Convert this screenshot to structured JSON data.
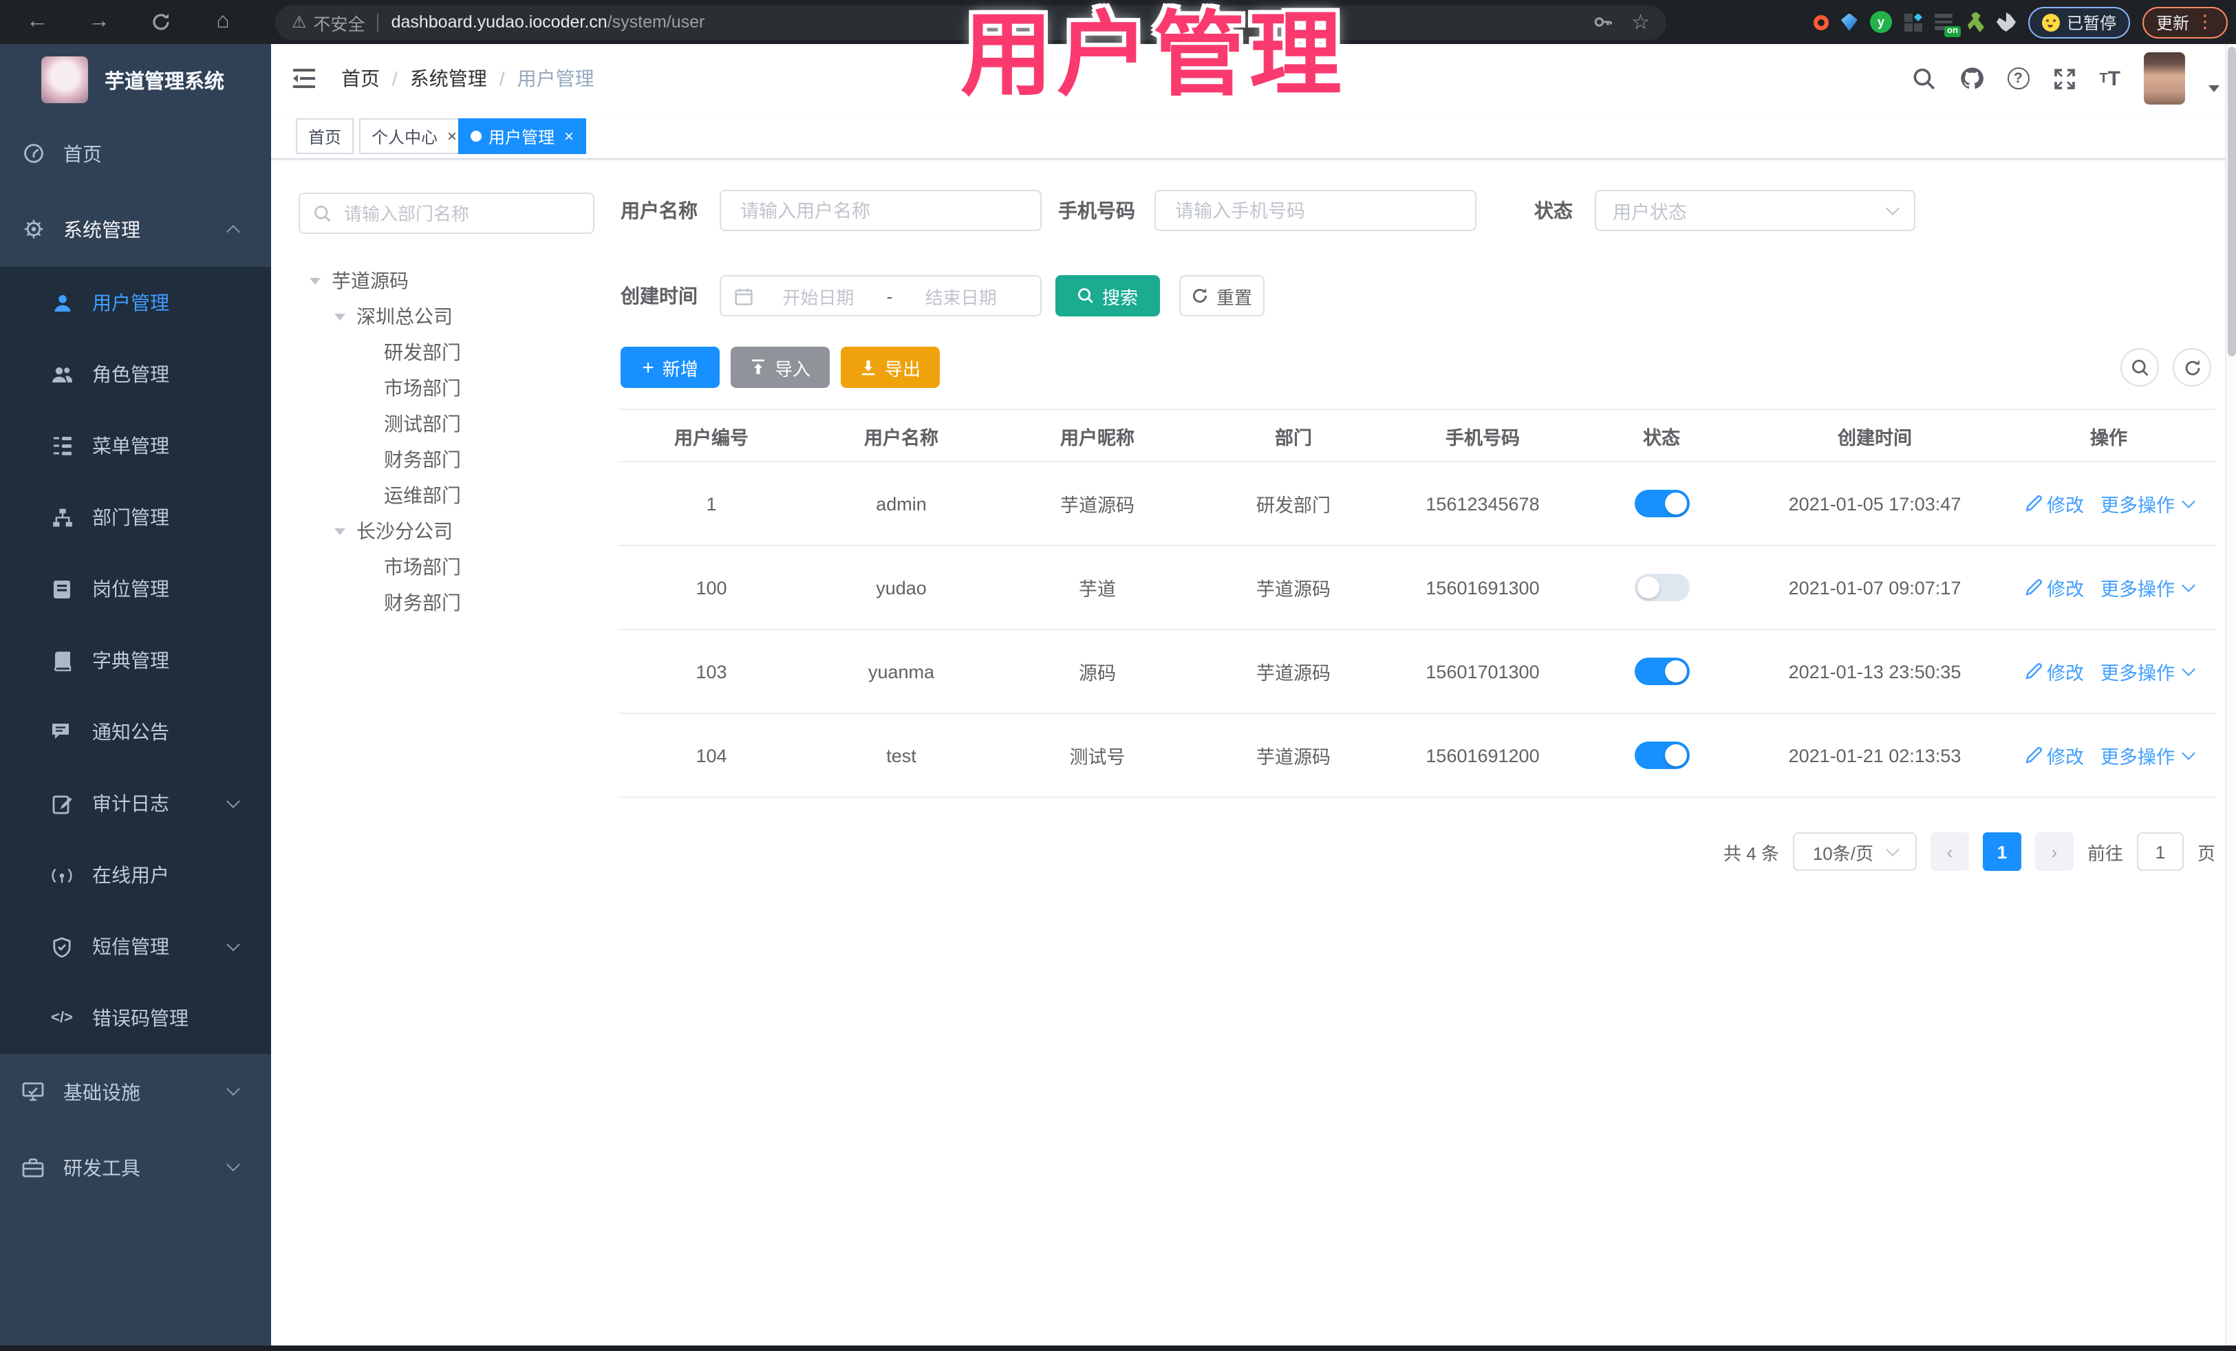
{
  "overlay": {
    "title": "用户管理",
    "color": "#fa3a6e"
  },
  "browser": {
    "security_label": "不安全",
    "url_host": "dashboard.yudao.iocoder.cn",
    "url_path": "/system/user",
    "extension_on_badge": "on",
    "paused_badge": "已暂停",
    "update_label": "更新"
  },
  "sidebar": {
    "app_title": "芋道管理系统",
    "items": [
      {
        "label": "首页"
      },
      {
        "label": "系统管理"
      },
      {
        "label": "基础设施"
      },
      {
        "label": "研发工具"
      }
    ],
    "system_children": [
      {
        "label": "用户管理"
      },
      {
        "label": "角色管理"
      },
      {
        "label": "菜单管理"
      },
      {
        "label": "部门管理"
      },
      {
        "label": "岗位管理"
      },
      {
        "label": "字典管理"
      },
      {
        "label": "通知公告"
      },
      {
        "label": "审计日志"
      },
      {
        "label": "在线用户"
      },
      {
        "label": "短信管理"
      },
      {
        "label": "错误码管理"
      }
    ]
  },
  "navbar": {
    "breadcrumb": [
      "首页",
      "系统管理",
      "用户管理"
    ]
  },
  "tabs": [
    {
      "label": "首页"
    },
    {
      "label": "个人中心"
    },
    {
      "label": "用户管理"
    }
  ],
  "tree": {
    "search_placeholder": "请输入部门名称",
    "nodes": [
      {
        "label": "芋道源码"
      },
      {
        "label": "深圳总公司"
      },
      {
        "label": "研发部门"
      },
      {
        "label": "市场部门"
      },
      {
        "label": "测试部门"
      },
      {
        "label": "财务部门"
      },
      {
        "label": "运维部门"
      },
      {
        "label": "长沙分公司"
      },
      {
        "label": "市场部门"
      },
      {
        "label": "财务部门"
      }
    ]
  },
  "filters": {
    "username": {
      "label": "用户名称",
      "placeholder": "请输入用户名称"
    },
    "mobile": {
      "label": "手机号码",
      "placeholder": "请输入手机号码"
    },
    "status": {
      "label": "状态",
      "placeholder": "用户状态"
    },
    "create_time": {
      "label": "创建时间",
      "start_placeholder": "开始日期",
      "separator": "-",
      "end_placeholder": "结束日期"
    },
    "search_label": "搜索",
    "reset_label": "重置"
  },
  "toolbar": {
    "add_label": "新增",
    "import_label": "导入",
    "export_label": "导出"
  },
  "table": {
    "columns": [
      "用户编号",
      "用户名称",
      "用户昵称",
      "部门",
      "手机号码",
      "状态",
      "创建时间",
      "操作"
    ],
    "actions": {
      "edit": "修改",
      "more": "更多操作"
    },
    "rows": [
      {
        "id": "1",
        "username": "admin",
        "nickname": "芋道源码",
        "dept": "研发部门",
        "mobile": "15612345678",
        "status": "on",
        "created": "2021-01-05 17:03:47"
      },
      {
        "id": "100",
        "username": "yudao",
        "nickname": "芋道",
        "dept": "芋道源码",
        "mobile": "15601691300",
        "status": "off",
        "created": "2021-01-07 09:07:17"
      },
      {
        "id": "103",
        "username": "yuanma",
        "nickname": "源码",
        "dept": "芋道源码",
        "mobile": "15601701300",
        "status": "on",
        "created": "2021-01-13 23:50:35"
      },
      {
        "id": "104",
        "username": "test",
        "nickname": "测试号",
        "dept": "芋道源码",
        "mobile": "15601691200",
        "status": "on",
        "created": "2021-01-21 02:13:53"
      }
    ]
  },
  "pagination": {
    "total": "共 4 条",
    "page_size": "10条/页",
    "current_page": "1",
    "goto_label": "前往",
    "goto_value": "1",
    "page_unit": "页"
  },
  "colors": {
    "primary": "#409eff",
    "toggle_on": "#1890ff",
    "active_tab": "#1890ff",
    "search_button": "#1aab90",
    "export_button": "#f0a20c",
    "import_button": "#909399",
    "sidebar_bg": "#304156",
    "submenu_bg": "#1f2d3d",
    "overlay_pink": "#fa3a6e"
  }
}
